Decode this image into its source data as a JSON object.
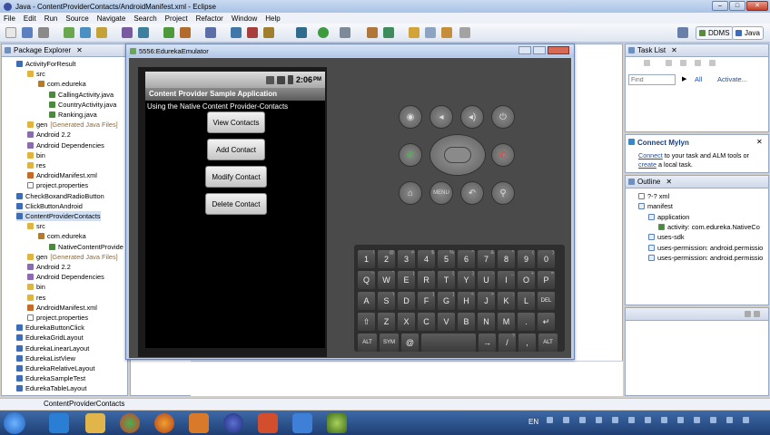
{
  "window": {
    "title": "Java - ContentProviderContacts/AndroidManifest.xml - Eclipse"
  },
  "menu": [
    "File",
    "Edit",
    "Run",
    "Source",
    "Navigate",
    "Search",
    "Project",
    "Refactor",
    "Window",
    "Help"
  ],
  "perspectives": {
    "ddms": "DDMS",
    "java": "Java"
  },
  "package_explorer": {
    "title": "Package Explorer",
    "items": [
      {
        "label": "ActivityForResult",
        "type": "proj"
      },
      {
        "label": "src",
        "type": "fold"
      },
      {
        "label": "com.edureka",
        "type": "pkg"
      },
      {
        "label": "CallingActivity.java",
        "type": "java"
      },
      {
        "label": "CountryActivity.java",
        "type": "java"
      },
      {
        "label": "Ranking.java",
        "type": "java"
      },
      {
        "label": "gen",
        "note": "[Generated Java Files]",
        "type": "fold"
      },
      {
        "label": "Android 2.2",
        "type": "lib"
      },
      {
        "label": "Android Dependencies",
        "type": "lib"
      },
      {
        "label": "bin",
        "type": "fold"
      },
      {
        "label": "res",
        "type": "fold"
      },
      {
        "label": "AndroidManifest.xml",
        "type": "xml"
      },
      {
        "label": "project.properties",
        "type": "file"
      },
      {
        "label": "CheckBoxandRadioButton",
        "type": "proj"
      },
      {
        "label": "ClickButtonAndroid",
        "type": "proj"
      },
      {
        "label": "ContentProviderContacts",
        "type": "proj"
      },
      {
        "label": "src",
        "type": "fold"
      },
      {
        "label": "com.edureka",
        "type": "pkg"
      },
      {
        "label": "NativeContentProvide",
        "type": "java"
      },
      {
        "label": "gen",
        "note": "[Generated Java Files]",
        "type": "fold"
      },
      {
        "label": "Android 2.2",
        "type": "lib"
      },
      {
        "label": "Android Dependencies",
        "type": "lib"
      },
      {
        "label": "bin",
        "type": "fold"
      },
      {
        "label": "res",
        "type": "fold"
      },
      {
        "label": "AndroidManifest.xml",
        "type": "xml"
      },
      {
        "label": "project.properties",
        "type": "file"
      },
      {
        "label": "EdurekaButtonClick",
        "type": "proj"
      },
      {
        "label": "EdurekaGridLayout",
        "type": "proj"
      },
      {
        "label": "EdurekaLinearLayout",
        "type": "proj"
      },
      {
        "label": "EdurekaListView",
        "type": "proj"
      },
      {
        "label": "EdurekaRelativeLayout",
        "type": "proj"
      },
      {
        "label": "EdurekaSampleTest",
        "type": "proj"
      },
      {
        "label": "EdurekaTableLayout",
        "type": "proj"
      }
    ]
  },
  "emulator": {
    "title": "5556:EdurekaEmulator",
    "status_time": "2:06",
    "status_ampm": "PM",
    "app_title": "Content Provider Sample Application",
    "subtitle": "Using the Native Content Provider-Contacts",
    "buttons": [
      "View Contacts",
      "Add Contact",
      "Modify Contact",
      "Delete Contact"
    ],
    "keyboard": {
      "row1": [
        [
          "1",
          "!"
        ],
        [
          "2",
          "@"
        ],
        [
          "3",
          "#"
        ],
        [
          "4",
          "$"
        ],
        [
          "5",
          "%"
        ],
        [
          "6",
          "^"
        ],
        [
          "7",
          "&"
        ],
        [
          "8",
          "*"
        ],
        [
          "9",
          "("
        ],
        [
          "0",
          ")"
        ]
      ],
      "row2": [
        [
          "Q",
          "~"
        ],
        [
          "W",
          "\""
        ],
        [
          "E",
          "|"
        ],
        [
          "R",
          "`"
        ],
        [
          "T",
          "{"
        ],
        [
          "Y",
          "}"
        ],
        [
          "U",
          "-"
        ],
        [
          "I",
          "_"
        ],
        [
          "O",
          "+"
        ],
        [
          "P",
          "="
        ]
      ],
      "row3": [
        [
          "A",
          ""
        ],
        [
          "S",
          "\\"
        ],
        [
          "D",
          ""
        ],
        [
          "F",
          "["
        ],
        [
          "G",
          "]"
        ],
        [
          "H",
          "<"
        ],
        [
          "J",
          ">"
        ],
        [
          "K",
          ";"
        ],
        [
          "L",
          ":"
        ],
        [
          "DEL",
          ""
        ]
      ],
      "row4": [
        [
          "⇧",
          ""
        ],
        [
          "Z",
          ""
        ],
        [
          "X",
          ""
        ],
        [
          "C",
          ""
        ],
        [
          "V",
          ""
        ],
        [
          "B",
          ""
        ],
        [
          "N",
          ""
        ],
        [
          "M",
          ""
        ],
        [
          ".",
          ""
        ],
        [
          "↵",
          ""
        ]
      ],
      "row5": [
        [
          "ALT",
          ""
        ],
        [
          "SYM",
          ""
        ],
        [
          "@",
          ""
        ],
        [
          "",
          ""
        ],
        [
          "→",
          ""
        ],
        [
          "/",
          "?"
        ],
        [
          ",",
          ""
        ],
        [
          "ALT",
          ""
        ]
      ]
    }
  },
  "task_list": {
    "title": "Task List",
    "find_placeholder": "Find",
    "all": "All",
    "activate": "Activate..."
  },
  "mylyn": {
    "title": "Connect Mylyn",
    "text_connect": "Connect",
    "text_mid": " to your task and ALM tools or ",
    "text_create": "create",
    "text_end": " a local task."
  },
  "outline": {
    "title": "Outline",
    "items": [
      {
        "label": "?-? xml",
        "indent": 0
      },
      {
        "label": "manifest",
        "indent": 0
      },
      {
        "label": "application",
        "indent": 1
      },
      {
        "label": "activity: com.edureka.NativeCo",
        "indent": 2
      },
      {
        "label": "uses-sdk",
        "indent": 1
      },
      {
        "label": "uses-permission: android.permissio",
        "indent": 1
      },
      {
        "label": "uses-permission: android.permissio",
        "indent": 1
      }
    ]
  },
  "status_bar": {
    "text": "ContentProviderContacts"
  },
  "taskbar": {
    "lang": "EN"
  }
}
